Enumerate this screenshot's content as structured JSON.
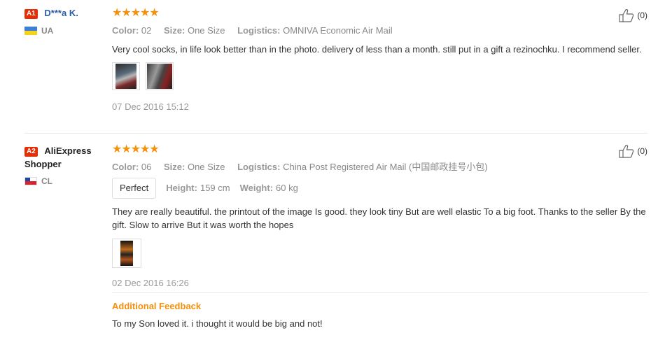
{
  "reviews": [
    {
      "badge": "A1",
      "name": "D***a K.",
      "country": "UA",
      "stars": "★★★★★",
      "color_label": "Color:",
      "color_value": "02",
      "size_label": "Size:",
      "size_value": "One Size",
      "logistics_label": "Logistics:",
      "logistics_value": "OMNIVA Economic Air Mail",
      "text": "Very cool socks, in life look better than in the photo. delivery of less than a month. still put in a gift a rezinochku. I recommend seller.",
      "date": "07 Dec 2016 15:12",
      "likes": "(0)"
    },
    {
      "badge": "A2",
      "name": "AliExpress Shopper",
      "country": "CL",
      "stars": "★★★★★",
      "color_label": "Color:",
      "color_value": "06",
      "size_label": "Size:",
      "size_value": "One Size",
      "logistics_label": "Logistics:",
      "logistics_value": "China Post Registered Air Mail (中国邮政挂号小包)",
      "fit_tag": "Perfect",
      "height_label": "Height:",
      "height_value": "159 cm",
      "weight_label": "Weight:",
      "weight_value": "60 kg",
      "text": "They are really beautiful. the printout of the image Is good. they look tiny But are well elastic To a big foot. Thanks to the seller By the gift. Slow to arrive But it was worth the hopes",
      "date": "02 Dec 2016 16:26",
      "likes": "(0)",
      "additional_title": "Additional Feedback",
      "additional_text": "To my Son loved it. i thought it would be big and not!"
    }
  ],
  "colors": {
    "accent": "#f5900b",
    "badge": "#e62e04",
    "link": "#2a5ca8"
  },
  "icons": {
    "like": "thumbs-up-icon",
    "star": "star-icon"
  }
}
